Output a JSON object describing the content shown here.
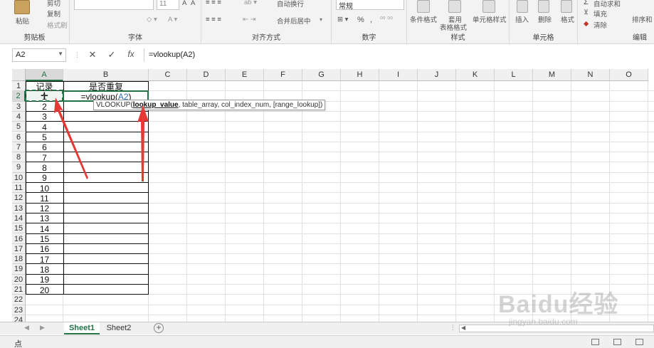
{
  "ribbon": {
    "clipboard": {
      "cut": "剪切",
      "paste": "粘贴",
      "copy": "复制",
      "format_painter": "格式刷",
      "label": "剪贴板"
    },
    "font": {
      "size": "11",
      "label": "字体"
    },
    "alignment": {
      "wrap_text": "自动换行",
      "merge_center": "合并后居中",
      "label": "对齐方式"
    },
    "number": {
      "format": "常规",
      "percent": "%",
      "comma": ",",
      "label": "数字"
    },
    "styles": {
      "conditional": "条件格式",
      "table_line1": "套用",
      "table_line2": "表格格式",
      "cell_styles": "单元格样式",
      "label": "样式"
    },
    "cells": {
      "insert": "插入",
      "delete": "删除",
      "format": "格式",
      "label": "单元格"
    },
    "editing": {
      "autosum": "自动求和",
      "fill": "填充",
      "clear": "清除",
      "sort": "排序和",
      "label": "编辑"
    }
  },
  "formula_bar": {
    "name_box": "A2",
    "cancel_icon": "✕",
    "enter_icon": "✓",
    "fx_label": "fx",
    "content": "=vlookup(A2)"
  },
  "columns": [
    "A",
    "B",
    "C",
    "D",
    "E",
    "F",
    "G",
    "H",
    "I",
    "J",
    "K",
    "L",
    "M",
    "N",
    "O"
  ],
  "selected_column": "A",
  "rows": [
    "1",
    "2",
    "3",
    "4",
    "5",
    "6",
    "7",
    "8",
    "9",
    "10",
    "11",
    "12",
    "13",
    "14",
    "15",
    "16",
    "17",
    "18",
    "19",
    "20",
    "21",
    "22",
    "23",
    "24"
  ],
  "table": {
    "header_a": "记录",
    "header_b": "是否重复",
    "records": [
      "1",
      "2",
      "3",
      "4",
      "5",
      "6",
      "7",
      "8",
      "9",
      "10",
      "11",
      "12",
      "13",
      "14",
      "15",
      "16",
      "17",
      "18",
      "19",
      "20"
    ],
    "b2_formula_prefix": "=vlookup(",
    "b2_formula_ref": "A2",
    "b2_formula_suffix": ")"
  },
  "tooltip": {
    "prefix": "VLOOKUP(",
    "bold_arg": "lookup_value",
    "rest": ", table_array, col_index_num, [range_lookup])"
  },
  "sheets": [
    "Sheet1",
    "Sheet2"
  ],
  "active_sheet": "Sheet1",
  "status": {
    "mode": "点"
  },
  "watermark": {
    "brand": "Baidu经验",
    "url": "jingyan.baidu.com"
  },
  "colors": {
    "accent": "#217346",
    "ref_blue": "#3a6fb0",
    "arrow_red": "#e53935"
  }
}
